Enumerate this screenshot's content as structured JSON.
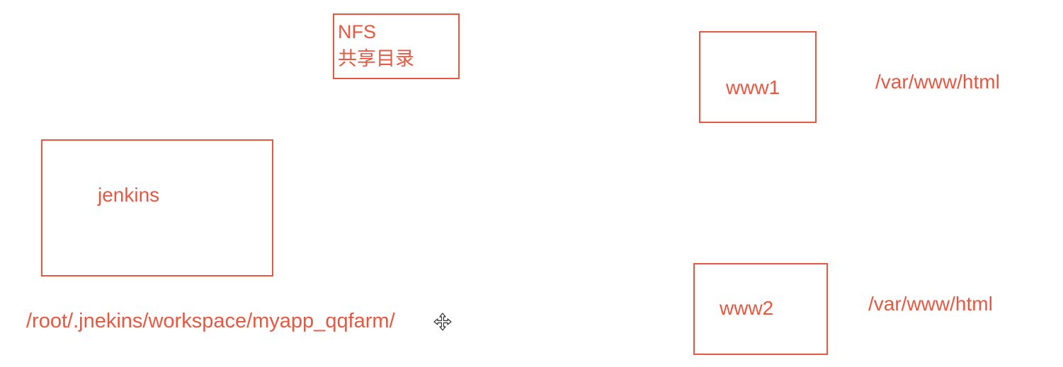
{
  "nfs": {
    "title": "NFS",
    "subtitle": "共享目录"
  },
  "jenkins": {
    "label": "jenkins",
    "path": "/root/.jnekins/workspace/myapp_qqfarm/"
  },
  "www1": {
    "label": "www1",
    "path": "/var/www/html"
  },
  "www2": {
    "label": "www2",
    "path": "/var/www/html"
  },
  "colors": {
    "accent": "#e8573f",
    "background": "#ffffff"
  },
  "icons": {
    "cursor": "move-cursor-icon"
  }
}
